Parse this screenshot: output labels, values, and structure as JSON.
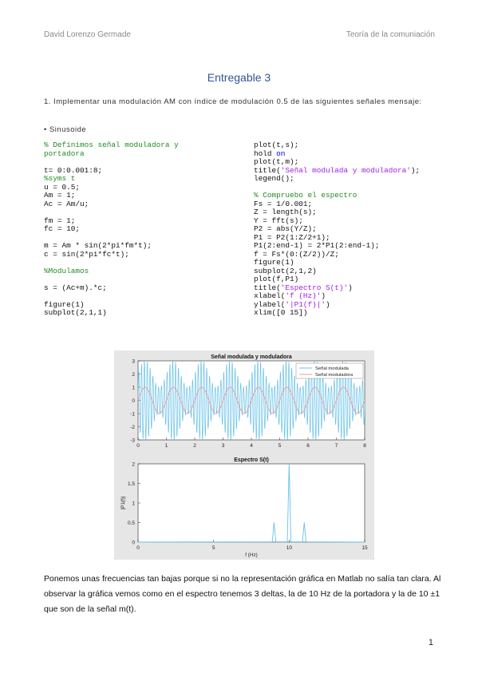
{
  "header": {
    "author": "David Lorenzo Germade",
    "course": "Teoría de la comuniación"
  },
  "title": "Entregable 3",
  "task": "1. Implementar una modulación AM con índice de modulación 0.5 de las siguientes señales mensaje:",
  "bullet": "• Sinusoide",
  "code_left": [
    {
      "t": "c",
      "v": "% Definimos señal moduladora y"
    },
    {
      "t": "c",
      "v": "portadora"
    },
    {
      "t": "gap",
      "v": ""
    },
    {
      "t": "n",
      "v": "t= 0:0.001:8;"
    },
    {
      "t": "c",
      "v": "%syms t"
    },
    {
      "t": "n",
      "v": "u = 0.5;"
    },
    {
      "t": "n",
      "v": "Am = 1;"
    },
    {
      "t": "n",
      "v": "Ac = Am/u;"
    },
    {
      "t": "gap",
      "v": ""
    },
    {
      "t": "n",
      "v": "fm = 1;"
    },
    {
      "t": "n",
      "v": "fc = 10;"
    },
    {
      "t": "gap",
      "v": ""
    },
    {
      "t": "n",
      "v": "m = Am * sin(2*pi*fm*t);"
    },
    {
      "t": "n",
      "v": "c = sin(2*pi*fc*t);"
    },
    {
      "t": "gap",
      "v": ""
    },
    {
      "t": "c",
      "v": "%Modulamos"
    },
    {
      "t": "gap",
      "v": ""
    },
    {
      "t": "n",
      "v": "s = (Ac+m).*c;"
    },
    {
      "t": "gap",
      "v": ""
    },
    {
      "t": "n",
      "v": "figure(1)"
    },
    {
      "t": "n",
      "v": "subplot(2,1,1)"
    }
  ],
  "code_right": [
    {
      "t": "n",
      "v": "plot(t,s);"
    },
    {
      "t": "mix",
      "parts": [
        [
          "n",
          "hold "
        ],
        [
          "k",
          "on"
        ]
      ]
    },
    {
      "t": "n",
      "v": "plot(t,m);"
    },
    {
      "t": "mix",
      "parts": [
        [
          "n",
          "title("
        ],
        [
          "s",
          "'Señal modulada y moduladora'"
        ],
        [
          "n",
          ");"
        ]
      ]
    },
    {
      "t": "n",
      "v": "legend();"
    },
    {
      "t": "gap",
      "v": ""
    },
    {
      "t": "c",
      "v": "% Compruebo el espectro"
    },
    {
      "t": "n",
      "v": "Fs = 1/0.001;"
    },
    {
      "t": "n",
      "v": "Z = length(s);"
    },
    {
      "t": "n",
      "v": "Y = fft(s);"
    },
    {
      "t": "n",
      "v": "P2 = abs(Y/Z);"
    },
    {
      "t": "n",
      "v": "P1 = P2(1:Z/2+1);"
    },
    {
      "t": "n",
      "v": "P1(2:end-1) = 2*P1(2:end-1);"
    },
    {
      "t": "n",
      "v": "f = Fs*(0:(Z/2))/Z;"
    },
    {
      "t": "n",
      "v": "figure(1)"
    },
    {
      "t": "n",
      "v": "subplot(2,1,2)"
    },
    {
      "t": "n",
      "v": "plot(f,P1)"
    },
    {
      "t": "mix",
      "parts": [
        [
          "n",
          "title("
        ],
        [
          "s",
          "'Espectro S(t)'"
        ],
        [
          "n",
          ")"
        ]
      ]
    },
    {
      "t": "mix",
      "parts": [
        [
          "n",
          "xlabel("
        ],
        [
          "s",
          "'f (Hz)'"
        ],
        [
          "n",
          ")"
        ]
      ]
    },
    {
      "t": "mix",
      "parts": [
        [
          "n",
          "ylabel("
        ],
        [
          "s",
          "'|P1(f)|'"
        ],
        [
          "n",
          ")"
        ]
      ]
    },
    {
      "t": "n",
      "v": "xlim([0 15])"
    }
  ],
  "chart_data": [
    {
      "type": "line",
      "title": "Señal modulada y moduladora",
      "xlabel": "",
      "ylabel": "",
      "xlim": [
        0,
        8
      ],
      "ylim": [
        -3,
        3
      ],
      "xticks": [
        "0",
        "1",
        "2",
        "3",
        "4",
        "5",
        "6",
        "7",
        "8"
      ],
      "yticks": [
        "3",
        "2",
        "1",
        "0",
        "-1",
        "-2",
        "-3"
      ],
      "legend_position": "top-right",
      "series": [
        {
          "name": "Señal modulada",
          "formula": "(2+sin(2*pi*1*t))*sin(2*pi*10*t)",
          "color": "#67c1e8"
        },
        {
          "name": "Señal moduladora",
          "formula": "sin(2*pi*1*t)",
          "color": "#e89a9a"
        }
      ]
    },
    {
      "type": "line",
      "title": "Espectro S(t)",
      "xlabel": "f (Hz)",
      "ylabel": "|P1(f)|",
      "xlim": [
        0,
        15
      ],
      "ylim": [
        0,
        2
      ],
      "xticks": [
        "0",
        "5",
        "10",
        "15"
      ],
      "yticks": [
        "2",
        "1.5",
        "1",
        "0.5",
        "0"
      ],
      "peaks": [
        {
          "x": 9,
          "y": 0.5
        },
        {
          "x": 10,
          "y": 2
        },
        {
          "x": 11,
          "y": 0.5
        }
      ],
      "color": "#67c1e8"
    }
  ],
  "caption": "Ponemos unas frecuencias tan bajas porque si no la representación gráfica en Matlab no salía tan clara. Al observar la gráfica vemos como en el espectro tenemos 3 deltas, la de 10 Hz de la portadora y la de 10 ±1 que son de la señal m(t).",
  "page_number": "1"
}
